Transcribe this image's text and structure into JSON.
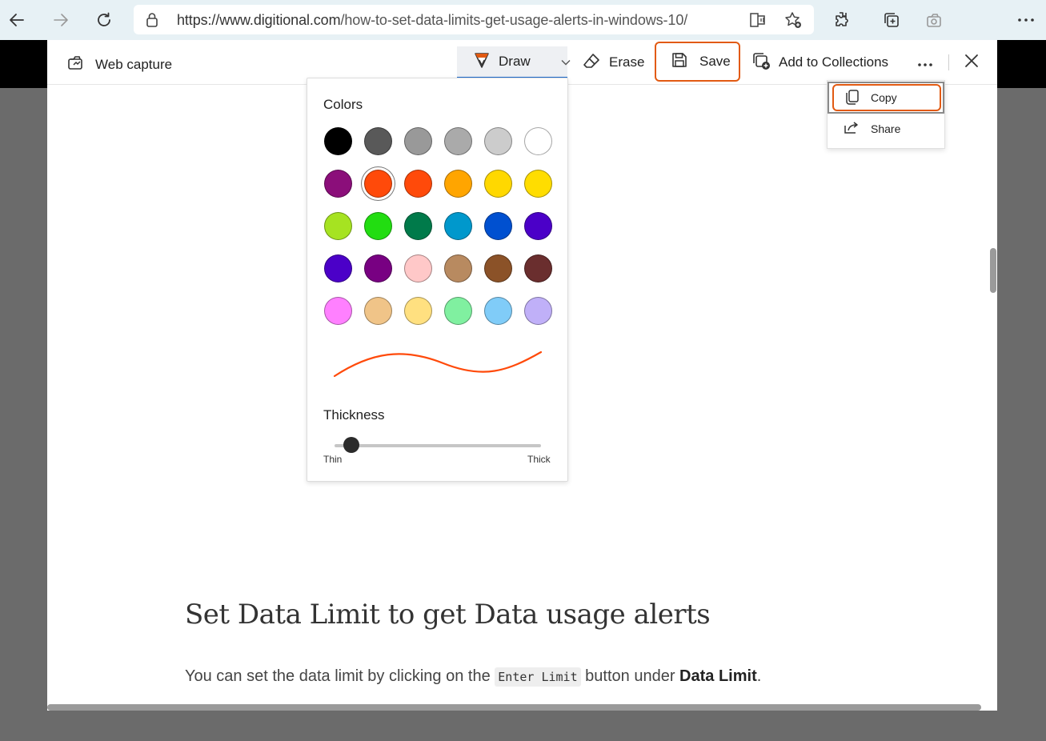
{
  "browser": {
    "url_host": "https://www.digitional.com",
    "url_path": "/how-to-set-data-limits-get-usage-alerts-in-windows-10/",
    "icons": [
      "back-icon",
      "forward-icon",
      "refresh-icon",
      "lock-icon",
      "read-aloud-icon",
      "add-favorite-icon",
      "extensions-icon",
      "collections-icon",
      "web-capture-icon",
      "more-icon"
    ]
  },
  "capture_toolbar": {
    "title": "Web capture",
    "draw_label": "Draw",
    "erase_label": "Erase",
    "save_label": "Save",
    "collections_label": "Add to Collections",
    "more_label": "...",
    "accent": "#e25a12"
  },
  "draw_panel": {
    "colors_heading": "Colors",
    "thickness_heading": "Thickness",
    "thin_label": "Thin",
    "thick_label": "Thick",
    "selected_color": "#ff4a0a",
    "thickness_level": 0.05,
    "swatches": [
      [
        "#000000",
        "#595959",
        "#999999",
        "#aaaaaa",
        "#cccccc",
        "#ffffff"
      ],
      [
        "#8b0e7a",
        "#ff4a0a",
        "#ff4a0a",
        "#ffa500",
        "#ffd800",
        "#ffdd00"
      ],
      [
        "#a6e321",
        "#22dd11",
        "#007a4a",
        "#0098cc",
        "#0050d0",
        "#4b00c8"
      ],
      [
        "#4b00c8",
        "#780082",
        "#ffc8c8",
        "#b88a60",
        "#8b5228",
        "#6a2e2e"
      ],
      [
        "#ff80ff",
        "#f0c488",
        "#ffe080",
        "#80f0a0",
        "#80ccf8",
        "#c0b0f8"
      ]
    ]
  },
  "save_menu": {
    "copy_label": "Copy",
    "share_label": "Share"
  },
  "article": {
    "heading": "Set Data Limit to get Data usage alerts",
    "text_before": "You can set the data limit by clicking on the ",
    "code": "Enter Limit",
    "text_middle": " button under ",
    "bold": "Data Limit",
    "text_after": "."
  }
}
